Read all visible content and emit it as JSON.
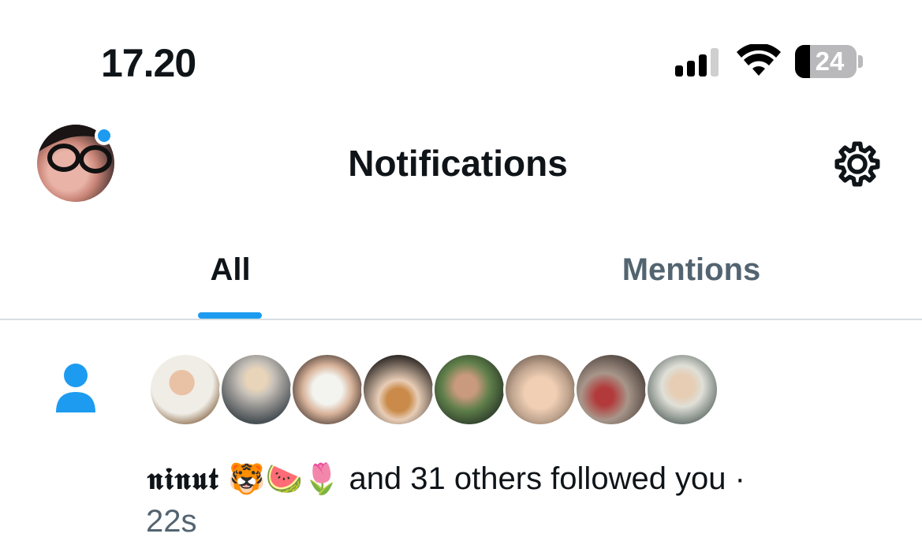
{
  "status_bar": {
    "time": "17.20",
    "battery_level": "24",
    "battery_fraction": 0.24
  },
  "header": {
    "title": "Notifications",
    "settings_icon": "gear-icon",
    "avatar_icon": "profile-avatar",
    "unread_dot_color": "#1d9bf0"
  },
  "tabs": [
    {
      "label": "All",
      "active": true
    },
    {
      "label": "Mentions",
      "active": false
    }
  ],
  "colors": {
    "accent": "#1d9bf0",
    "text_primary": "#0f1419",
    "text_secondary": "#536471",
    "divider": "#d7dee3"
  },
  "notification": {
    "icon": "person-icon",
    "avatar_count": 8,
    "name": "𝖓𝖎𝖓𝖚𝖙",
    "emojis": "🐯🍉🌷",
    "text": " and 31 others followed you ·",
    "time": "22s"
  }
}
